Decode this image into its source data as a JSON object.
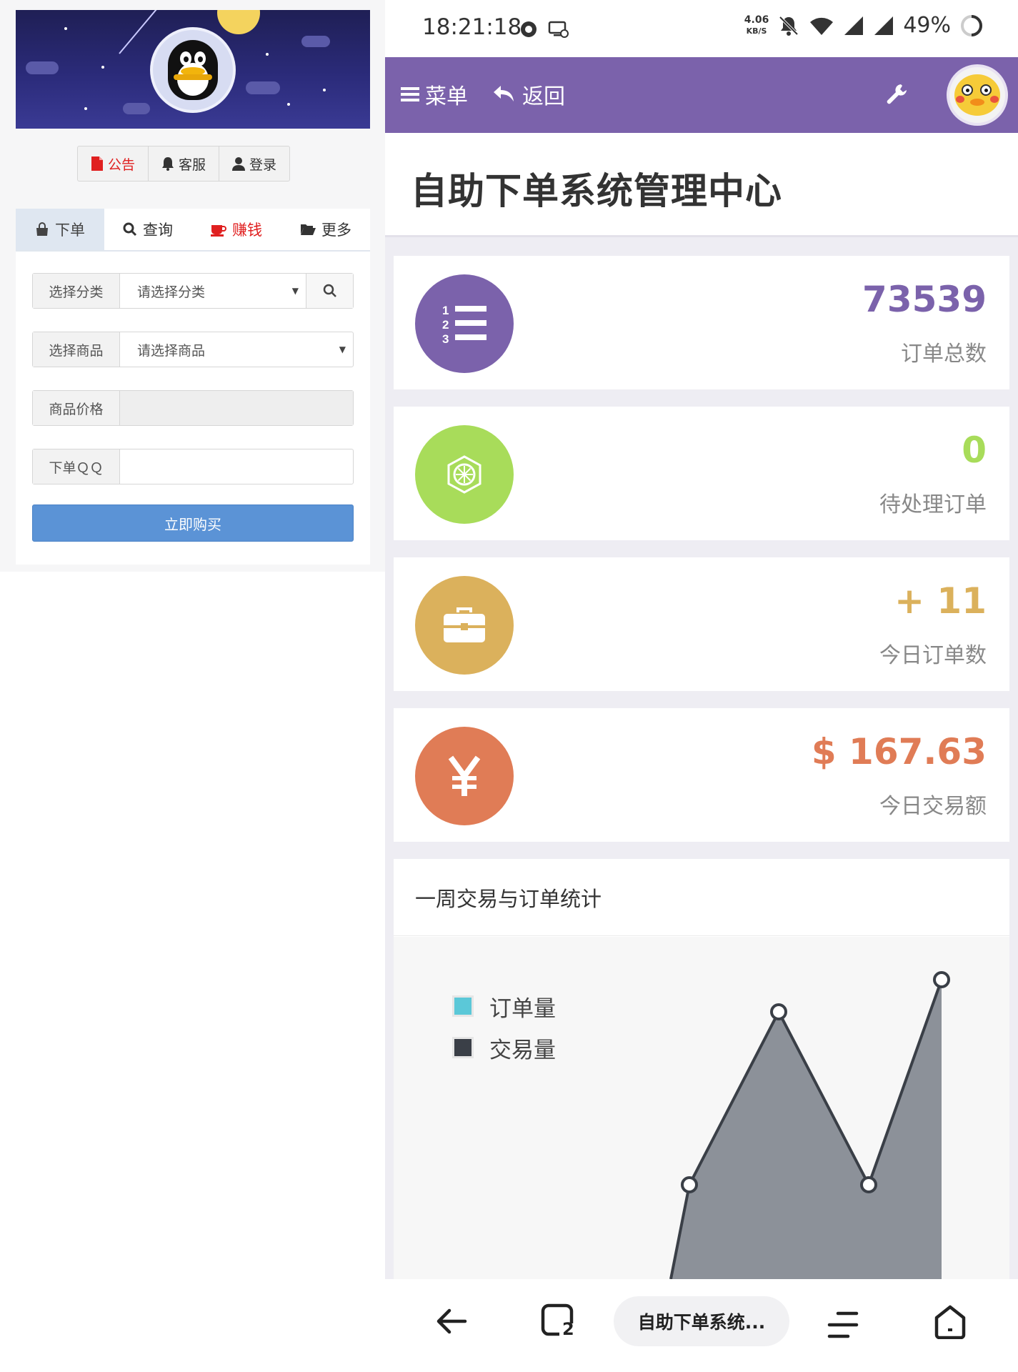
{
  "left": {
    "notice_buttons": [
      {
        "label": "公告",
        "icon": "document-icon",
        "color": "#e02020"
      },
      {
        "label": "客服",
        "icon": "bell-icon",
        "color": "#333333"
      },
      {
        "label": "登录",
        "icon": "user-icon",
        "color": "#333333"
      }
    ],
    "tabs": [
      {
        "label": "下单",
        "icon": "shopping-bag-icon",
        "active": true
      },
      {
        "label": "查询",
        "icon": "search-icon",
        "active": false
      },
      {
        "label": "赚钱",
        "icon": "coffee-cup-icon",
        "active": false,
        "color": "#e02020"
      },
      {
        "label": "更多",
        "icon": "folder-open-icon",
        "active": false
      }
    ],
    "form": {
      "category": {
        "label": "选择分类",
        "value": "请选择分类"
      },
      "product": {
        "label": "选择商品",
        "value": "请选择商品"
      },
      "price": {
        "label": "商品价格",
        "value": ""
      },
      "qq": {
        "label": "下单ＱＱ",
        "value": ""
      },
      "buy_label": "立即购买"
    }
  },
  "status_bar": {
    "time": "18:21:18",
    "speed_value": "4.06",
    "speed_unit": "KB/S",
    "battery": "49%"
  },
  "navbar": {
    "menu_label": "菜单",
    "back_label": "返回",
    "color": "#7b62ab"
  },
  "page_title": "自助下单系统管理中心",
  "stats": [
    {
      "value": "73539",
      "label": "订单总数",
      "color": "#7b62ab",
      "icon": "numbered-list-icon"
    },
    {
      "value": "0",
      "label": "待处理订单",
      "color": "#a8dc5a",
      "icon": "hexagon-badge-icon"
    },
    {
      "value": "+ 11",
      "label": "今日订单数",
      "color": "#dbb15c",
      "icon": "briefcase-icon"
    },
    {
      "value": "$ 167.63",
      "label": "今日交易额",
      "color": "#e07c56",
      "icon": "yen-icon"
    }
  ],
  "chart_section_title": "一周交易与订单统计",
  "chart_data": {
    "type": "area",
    "title": "一周交易与订单统计",
    "series": [
      {
        "name": "订单量",
        "color": "#5bc8d8",
        "values": []
      },
      {
        "name": "交易量",
        "color": "#3a3f47",
        "values": []
      }
    ]
  },
  "bottom_nav": {
    "tab_count": "2",
    "active_page_label": "自助下单系统..."
  }
}
